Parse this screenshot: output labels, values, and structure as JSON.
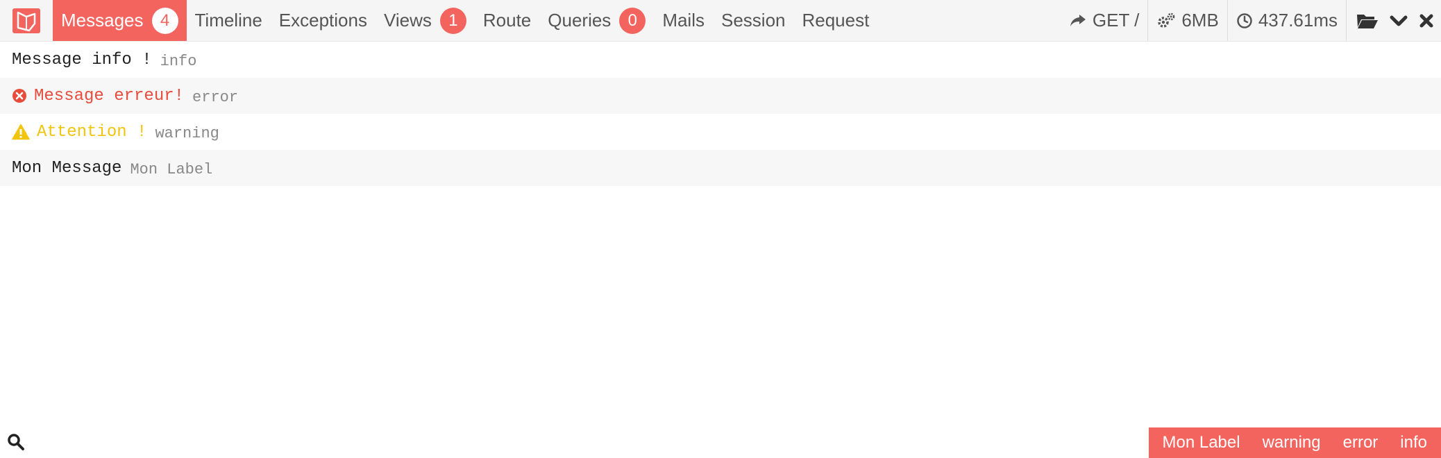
{
  "header": {
    "logo": "laravel-logo-icon",
    "tabs": [
      {
        "label": "Messages",
        "badge": "4",
        "active": true
      },
      {
        "label": "Timeline"
      },
      {
        "label": "Exceptions"
      },
      {
        "label": "Views",
        "badge": "1"
      },
      {
        "label": "Route"
      },
      {
        "label": "Queries",
        "badge": "0"
      },
      {
        "label": "Mails"
      },
      {
        "label": "Session"
      },
      {
        "label": "Request"
      }
    ],
    "indicators": {
      "request": "GET /",
      "memory": "6MB",
      "time": "437.61ms"
    },
    "controls": [
      "folder-open-icon",
      "chevron-down-icon",
      "close-icon"
    ]
  },
  "messages": [
    {
      "text": "Message info !",
      "label": "info",
      "level": "info"
    },
    {
      "text": "Message erreur!",
      "label": "error",
      "level": "error"
    },
    {
      "text": "Attention !",
      "label": "warning",
      "level": "warning"
    },
    {
      "text": "Mon Message",
      "label": "Mon Label",
      "level": "custom"
    }
  ],
  "filters": [
    "Mon Label",
    "warning",
    "error",
    "info"
  ],
  "colors": {
    "accent": "#f4645f",
    "error": "#e74c3c",
    "warning": "#f1c40f",
    "muted": "#888888"
  }
}
